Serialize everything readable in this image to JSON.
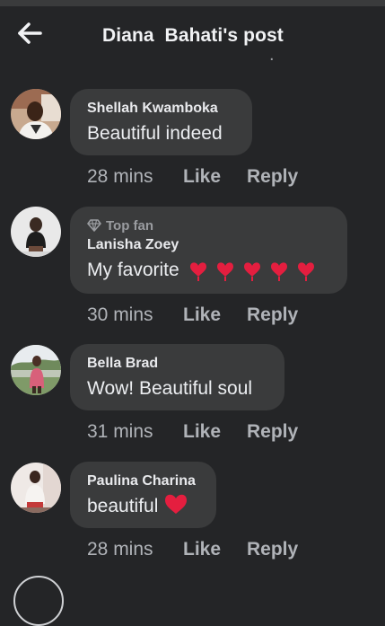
{
  "header": {
    "title": "Diana  Bahati's post",
    "back_icon": "arrow-left-icon"
  },
  "colors": {
    "background": "#242527",
    "bubble": "#3a3b3c",
    "heart": "#e41e3f"
  },
  "comments": [
    {
      "author": "Shellah Kwamboka",
      "text": "Beautiful indeed",
      "badge": "",
      "emoji": "",
      "time": "28 mins",
      "like": "Like",
      "reply": "Reply"
    },
    {
      "author": "Lanisha Zoey",
      "text": "My favorite",
      "badge": "Top fan",
      "badge_icon": "diamond-icon",
      "emoji": "heart x5",
      "time": "30 mins",
      "like": "Like",
      "reply": "Reply"
    },
    {
      "author": "Bella Brad",
      "text": "Wow! Beautiful soul",
      "badge": "",
      "emoji": "",
      "time": "31 mins",
      "like": "Like",
      "reply": "Reply"
    },
    {
      "author": "Paulina Charina",
      "text": "beautiful",
      "badge": "",
      "emoji": "heart",
      "time": "28 mins",
      "like": "Like",
      "reply": "Reply"
    }
  ]
}
